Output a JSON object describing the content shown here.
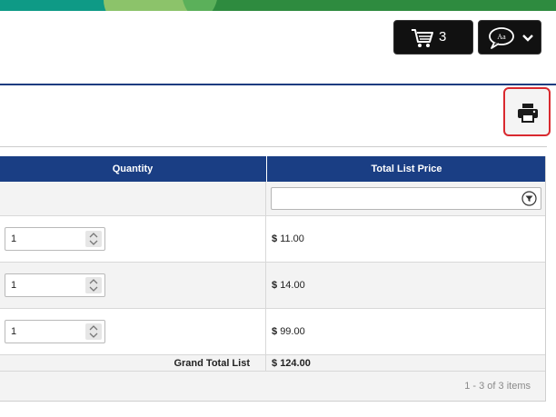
{
  "header": {
    "cart": {
      "count": "3",
      "icon": "cart-icon"
    },
    "language": {
      "icon": "language-bubble-icon",
      "icon_text": "Aa",
      "chevron": "chevron-down-icon"
    },
    "print": {
      "icon": "printer-icon"
    }
  },
  "grid": {
    "columns": [
      {
        "label": "Quantity"
      },
      {
        "label": "Total List Price"
      }
    ],
    "rows": [
      {
        "quantity": "1",
        "currency": "$",
        "price": "11.00"
      },
      {
        "quantity": "1",
        "currency": "$",
        "price": "14.00"
      },
      {
        "quantity": "1",
        "currency": "$",
        "price": "99.00"
      }
    ],
    "grand_total": {
      "label": "Grand Total List",
      "currency": "$",
      "value": "124.00"
    },
    "pager": {
      "info": "1 - 3 of 3 items"
    }
  },
  "colors": {
    "header_bg": "#1a3e84",
    "banner_green": "#2e8b3f",
    "banner_teal": "#0e9a86",
    "print_outline": "#d9292f"
  }
}
